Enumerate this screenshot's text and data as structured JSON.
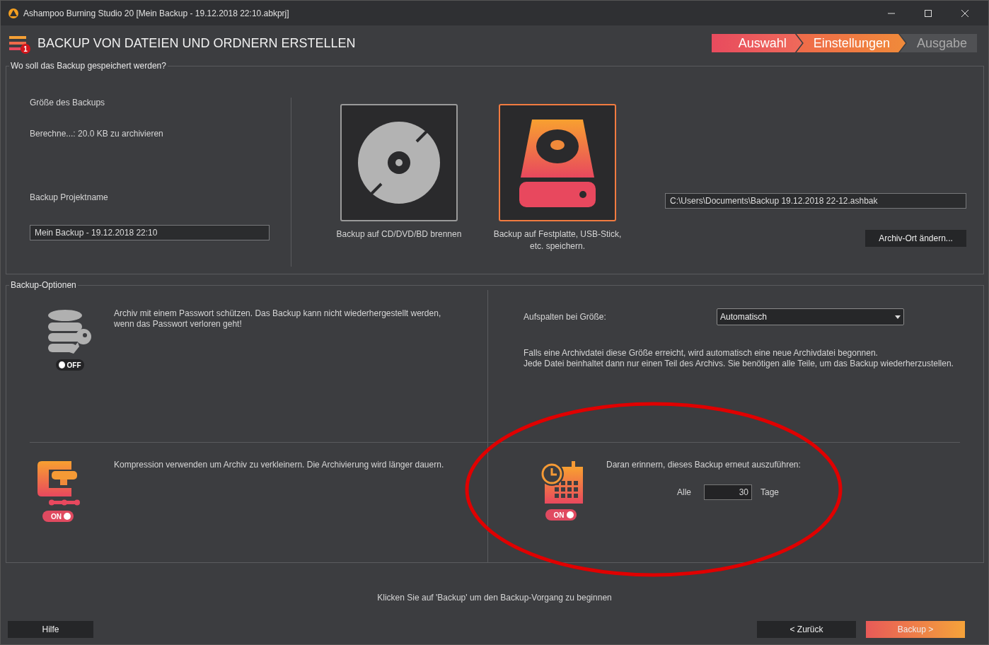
{
  "window": {
    "title": "Ashampoo Burning Studio 20 [Mein Backup - 19.12.2018 22:10.abkprj]"
  },
  "header": {
    "title": "BACKUP VON DATEIEN UND ORDNERN ERSTELLEN",
    "badge": "1"
  },
  "steps": [
    {
      "label": "Auswahl",
      "completed": true,
      "selected": false
    },
    {
      "label": "Einstellungen",
      "completed": false,
      "selected": true
    },
    {
      "label": "Ausgabe",
      "completed": false,
      "selected": false
    }
  ],
  "destination_group": {
    "title": "Wo soll das Backup gespeichert werden?",
    "size_label": "Größe des Backups",
    "size_value": "Berechne...:  20.0 KB zu archivieren",
    "name_label": "Backup Projektname",
    "name_value": "Mein Backup - 19.12.2018 22:10",
    "targets": [
      {
        "kind": "disc",
        "label": "Backup auf CD/DVD/BD brennen",
        "selected": false
      },
      {
        "kind": "drive",
        "label": "Backup auf Festplatte, USB-Stick, etc. speichern.",
        "selected": true
      }
    ],
    "path_value": "C:\\Users\\Documents\\Backup 19.12.2018 22-12.ashbak",
    "change_button": "Archiv-Ort ändern..."
  },
  "options_group": {
    "title": "Backup-Optionen",
    "options": [
      {
        "kind": "password",
        "text": "Archiv mit einem Passwort schützen. Das Backup kann nicht wiederhergestellt werden, wenn das Passwort verloren geht!",
        "on": false,
        "toggle_label": "OFF"
      },
      {
        "kind": "compression",
        "text": "Kompression verwenden um Archiv zu verkleinern. Die Archivierung wird länger dauern.",
        "on": true,
        "toggle_label": "ON"
      }
    ],
    "split": {
      "label": "Aufspalten bei Größe:",
      "value": "Automatisch",
      "lines": [
        "Falls eine Archivdatei diese Größe erreicht, wird automatisch eine neue Archivdatei begonnen.",
        "Jede Datei beinhaltet dann nur einen Teil des Archivs. Sie benötigen alle Teile, um das Backup wiederherzustellen."
      ]
    },
    "reminder": {
      "text": "Daran erinnern, dieses Backup erneut auszuführen:",
      "prefix": "Alle",
      "days": "30",
      "suffix": "Tage",
      "on": true,
      "toggle_label": "ON"
    }
  },
  "footer": {
    "hint": "Klicken Sie auf 'Backup' um den Backup-Vorgang zu beginnen",
    "help": "Hilfe",
    "back": "< Zurück",
    "next": "Backup >"
  }
}
